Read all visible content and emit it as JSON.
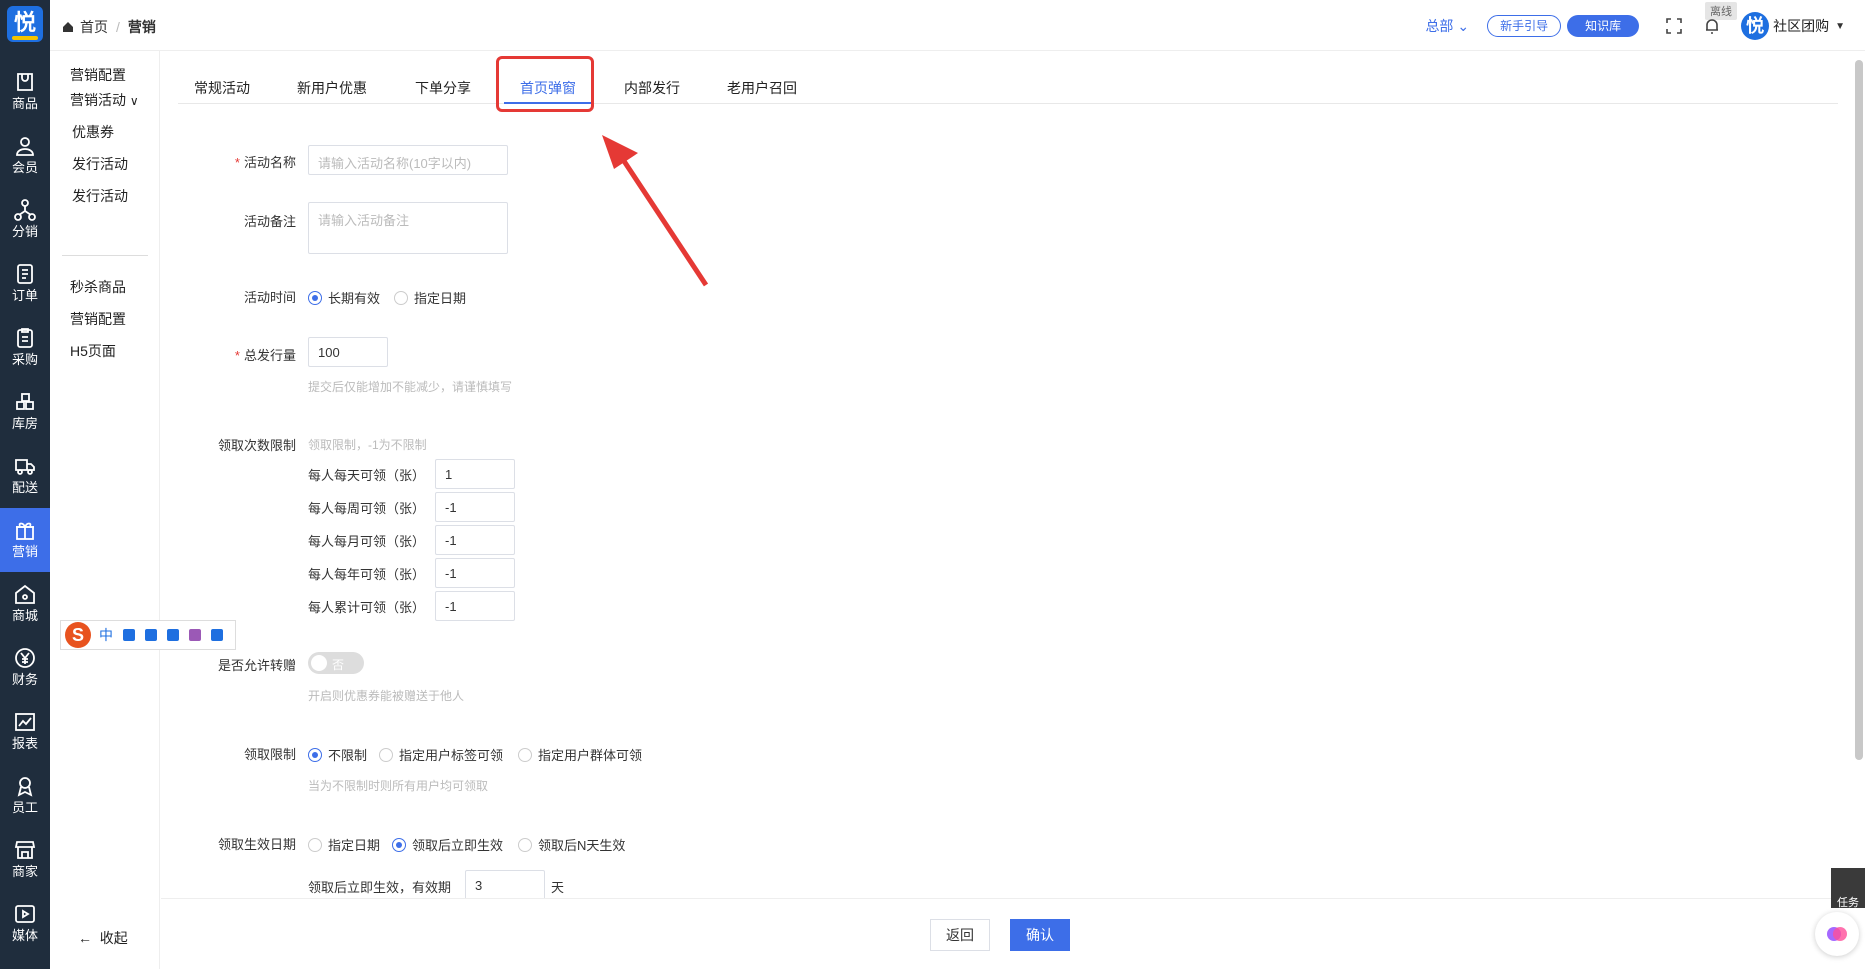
{
  "app": {
    "logo_char": "悦"
  },
  "rail": [
    {
      "label": "商品",
      "icon": "bag-icon"
    },
    {
      "label": "会员",
      "icon": "user-icon"
    },
    {
      "label": "分销",
      "icon": "network-icon"
    },
    {
      "label": "订单",
      "icon": "document-icon"
    },
    {
      "label": "采购",
      "icon": "clipboard-icon"
    },
    {
      "label": "库房",
      "icon": "grid-icon"
    },
    {
      "label": "配送",
      "icon": "truck-icon"
    },
    {
      "label": "营销",
      "icon": "gift-icon",
      "active": true
    },
    {
      "label": "商城",
      "icon": "home-icon"
    },
    {
      "label": "财务",
      "icon": "yen-icon"
    },
    {
      "label": "报表",
      "icon": "chart-icon"
    },
    {
      "label": "员工",
      "icon": "badge-icon"
    },
    {
      "label": "商家",
      "icon": "store-icon"
    },
    {
      "label": "媒体",
      "icon": "play-icon"
    }
  ],
  "header": {
    "breadcrumb_home": "首页",
    "breadcrumb_current": "营销",
    "hq": "总部",
    "guide_btn": "新手引导",
    "kb_btn": "知识库",
    "offline": "离线",
    "user_name": "社区团购"
  },
  "subnav": {
    "items": [
      "营销配置",
      "营销活动",
      "优惠券",
      "发行活动",
      "发行活动",
      "秒杀商品",
      "营销配置",
      "H5页面"
    ],
    "collapse": "收起"
  },
  "tabs": [
    "常规活动",
    "新用户优惠",
    "下单分享",
    "首页弹窗",
    "内部发行",
    "老用户召回"
  ],
  "form": {
    "name_label": "活动名称",
    "name_placeholder": "请输入活动名称(10字以内)",
    "remark_label": "活动备注",
    "remark_placeholder": "请输入活动备注",
    "time_label": "活动时间",
    "time_opt1": "长期有效",
    "time_opt2": "指定日期",
    "total_label": "总发行量",
    "total_value": "100",
    "total_hint": "提交后仅能增加不能减少，请谨慎填写",
    "limit_label": "领取次数限制",
    "limit_hint": "领取限制，-1为不限制",
    "limits": [
      {
        "label": "每人每天可领（张）",
        "value": "1"
      },
      {
        "label": "每人每周可领（张）",
        "value": "-1"
      },
      {
        "label": "每人每月可领（张）",
        "value": "-1"
      },
      {
        "label": "每人每年可领（张）",
        "value": "-1"
      },
      {
        "label": "每人累计可领（张）",
        "value": "-1"
      }
    ],
    "gift_label": "是否允许转赠",
    "gift_toggle": "否",
    "gift_hint": "开启则优惠券能被赠送于他人",
    "scope_label": "领取限制",
    "scope_opt1": "不限制",
    "scope_opt2": "指定用户标签可领",
    "scope_opt3": "指定用户群体可领",
    "scope_hint": "当为不限制时则所有用户均可领取",
    "eff_label": "领取生效日期",
    "eff_opt1": "指定日期",
    "eff_opt2": "领取后立即生效",
    "eff_opt3": "领取后N天生效",
    "valid_prefix": "领取后立即生效，有效期",
    "valid_value": "3",
    "valid_unit": "天"
  },
  "ime": {
    "logo": "S",
    "lang": "中"
  },
  "footer": {
    "back": "返回",
    "confirm": "确认"
  },
  "corner": {
    "text": "任务"
  },
  "colors": {
    "primary": "#3d6ee8",
    "rail_bg": "#1f2d3d",
    "annotation": "#e53935"
  }
}
